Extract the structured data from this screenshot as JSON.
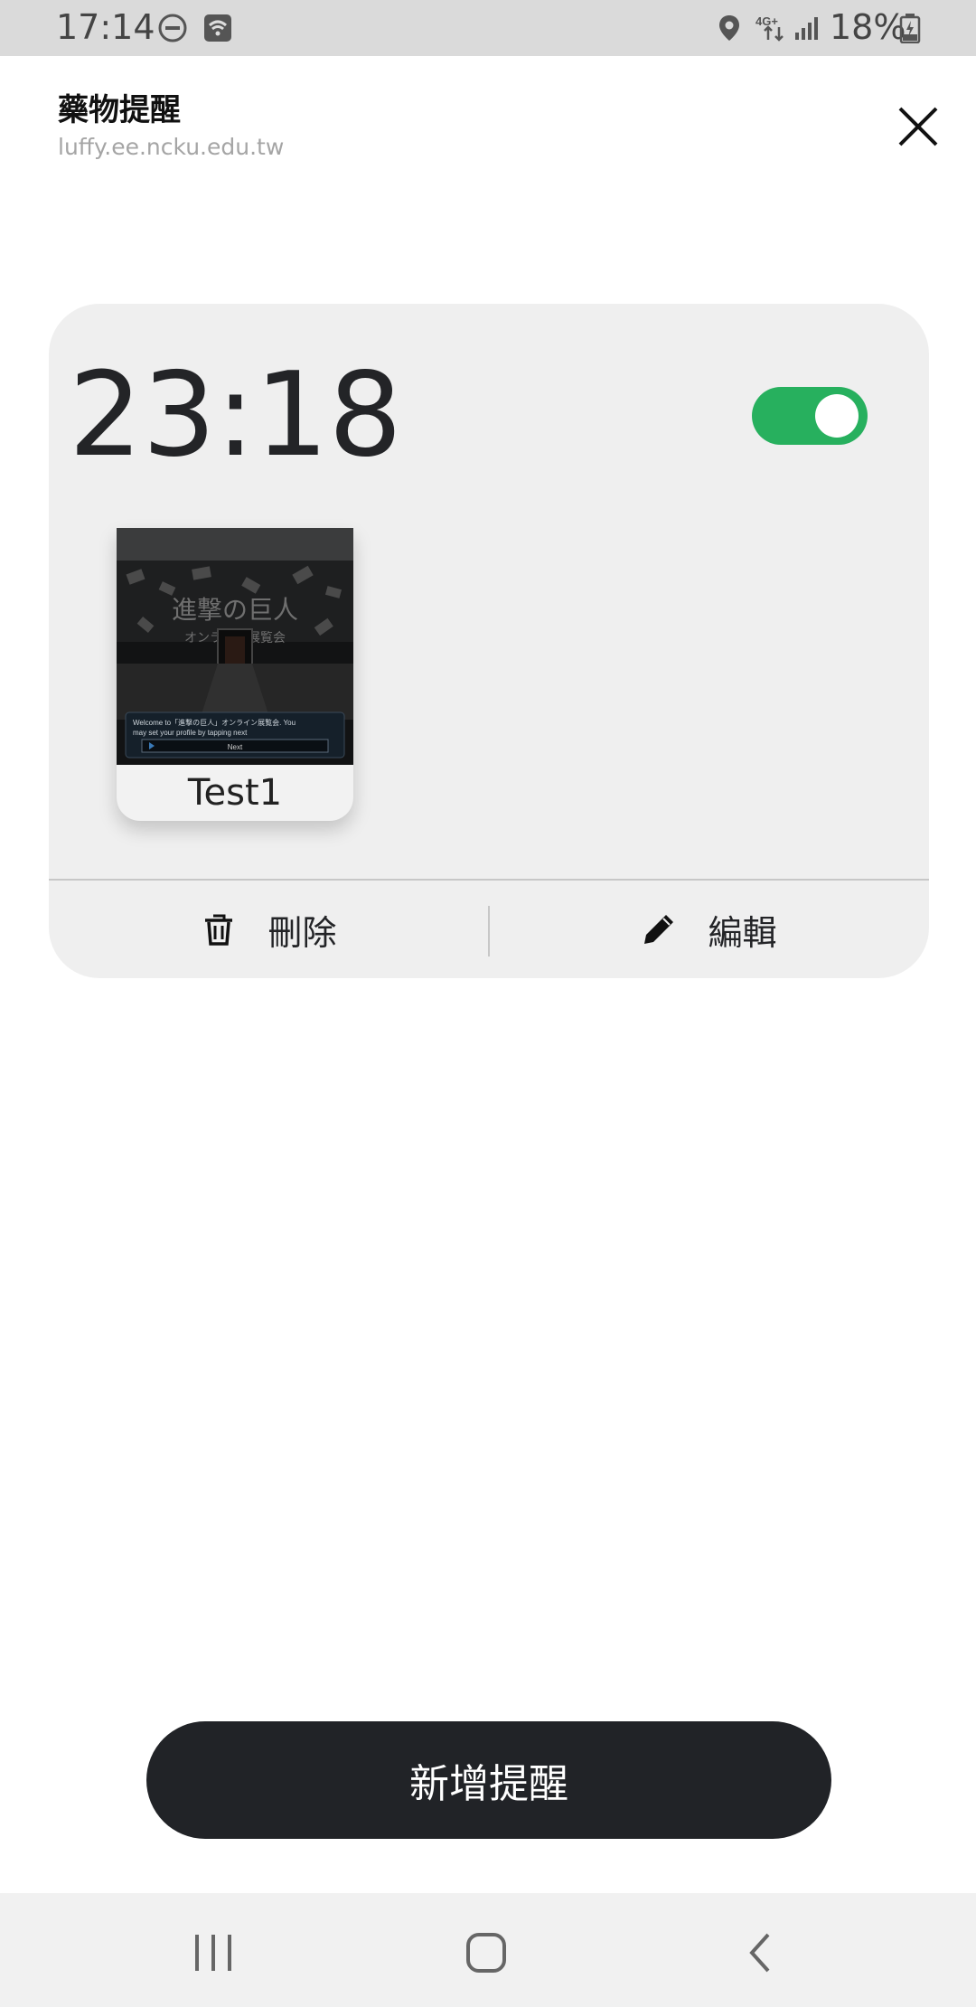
{
  "status_bar": {
    "time": "17:14",
    "network": "4G+",
    "battery": "18%",
    "icons": [
      "do-not-disturb-icon",
      "wifi-call-icon",
      "location-icon",
      "signal-icon",
      "battery-icon"
    ]
  },
  "header": {
    "title": "藥物提醒",
    "url": "luffy.ee.ncku.edu.tw",
    "close_icon": "close-icon"
  },
  "reminder": {
    "time": "23:18",
    "enabled": true,
    "accent_color": "#27b05e",
    "item": {
      "label": "Test1",
      "image_text": "Welcome to「進撃の巨人」オンライン展覧会. You may set your profile by tapping next",
      "image_button": "Next"
    },
    "actions": {
      "delete_label": "刪除",
      "edit_label": "編輯"
    }
  },
  "primary_button": {
    "label": "新增提醒",
    "color": "#212327"
  },
  "nav_bar": {
    "items": [
      "recent-apps-icon",
      "home-icon",
      "back-icon"
    ]
  }
}
